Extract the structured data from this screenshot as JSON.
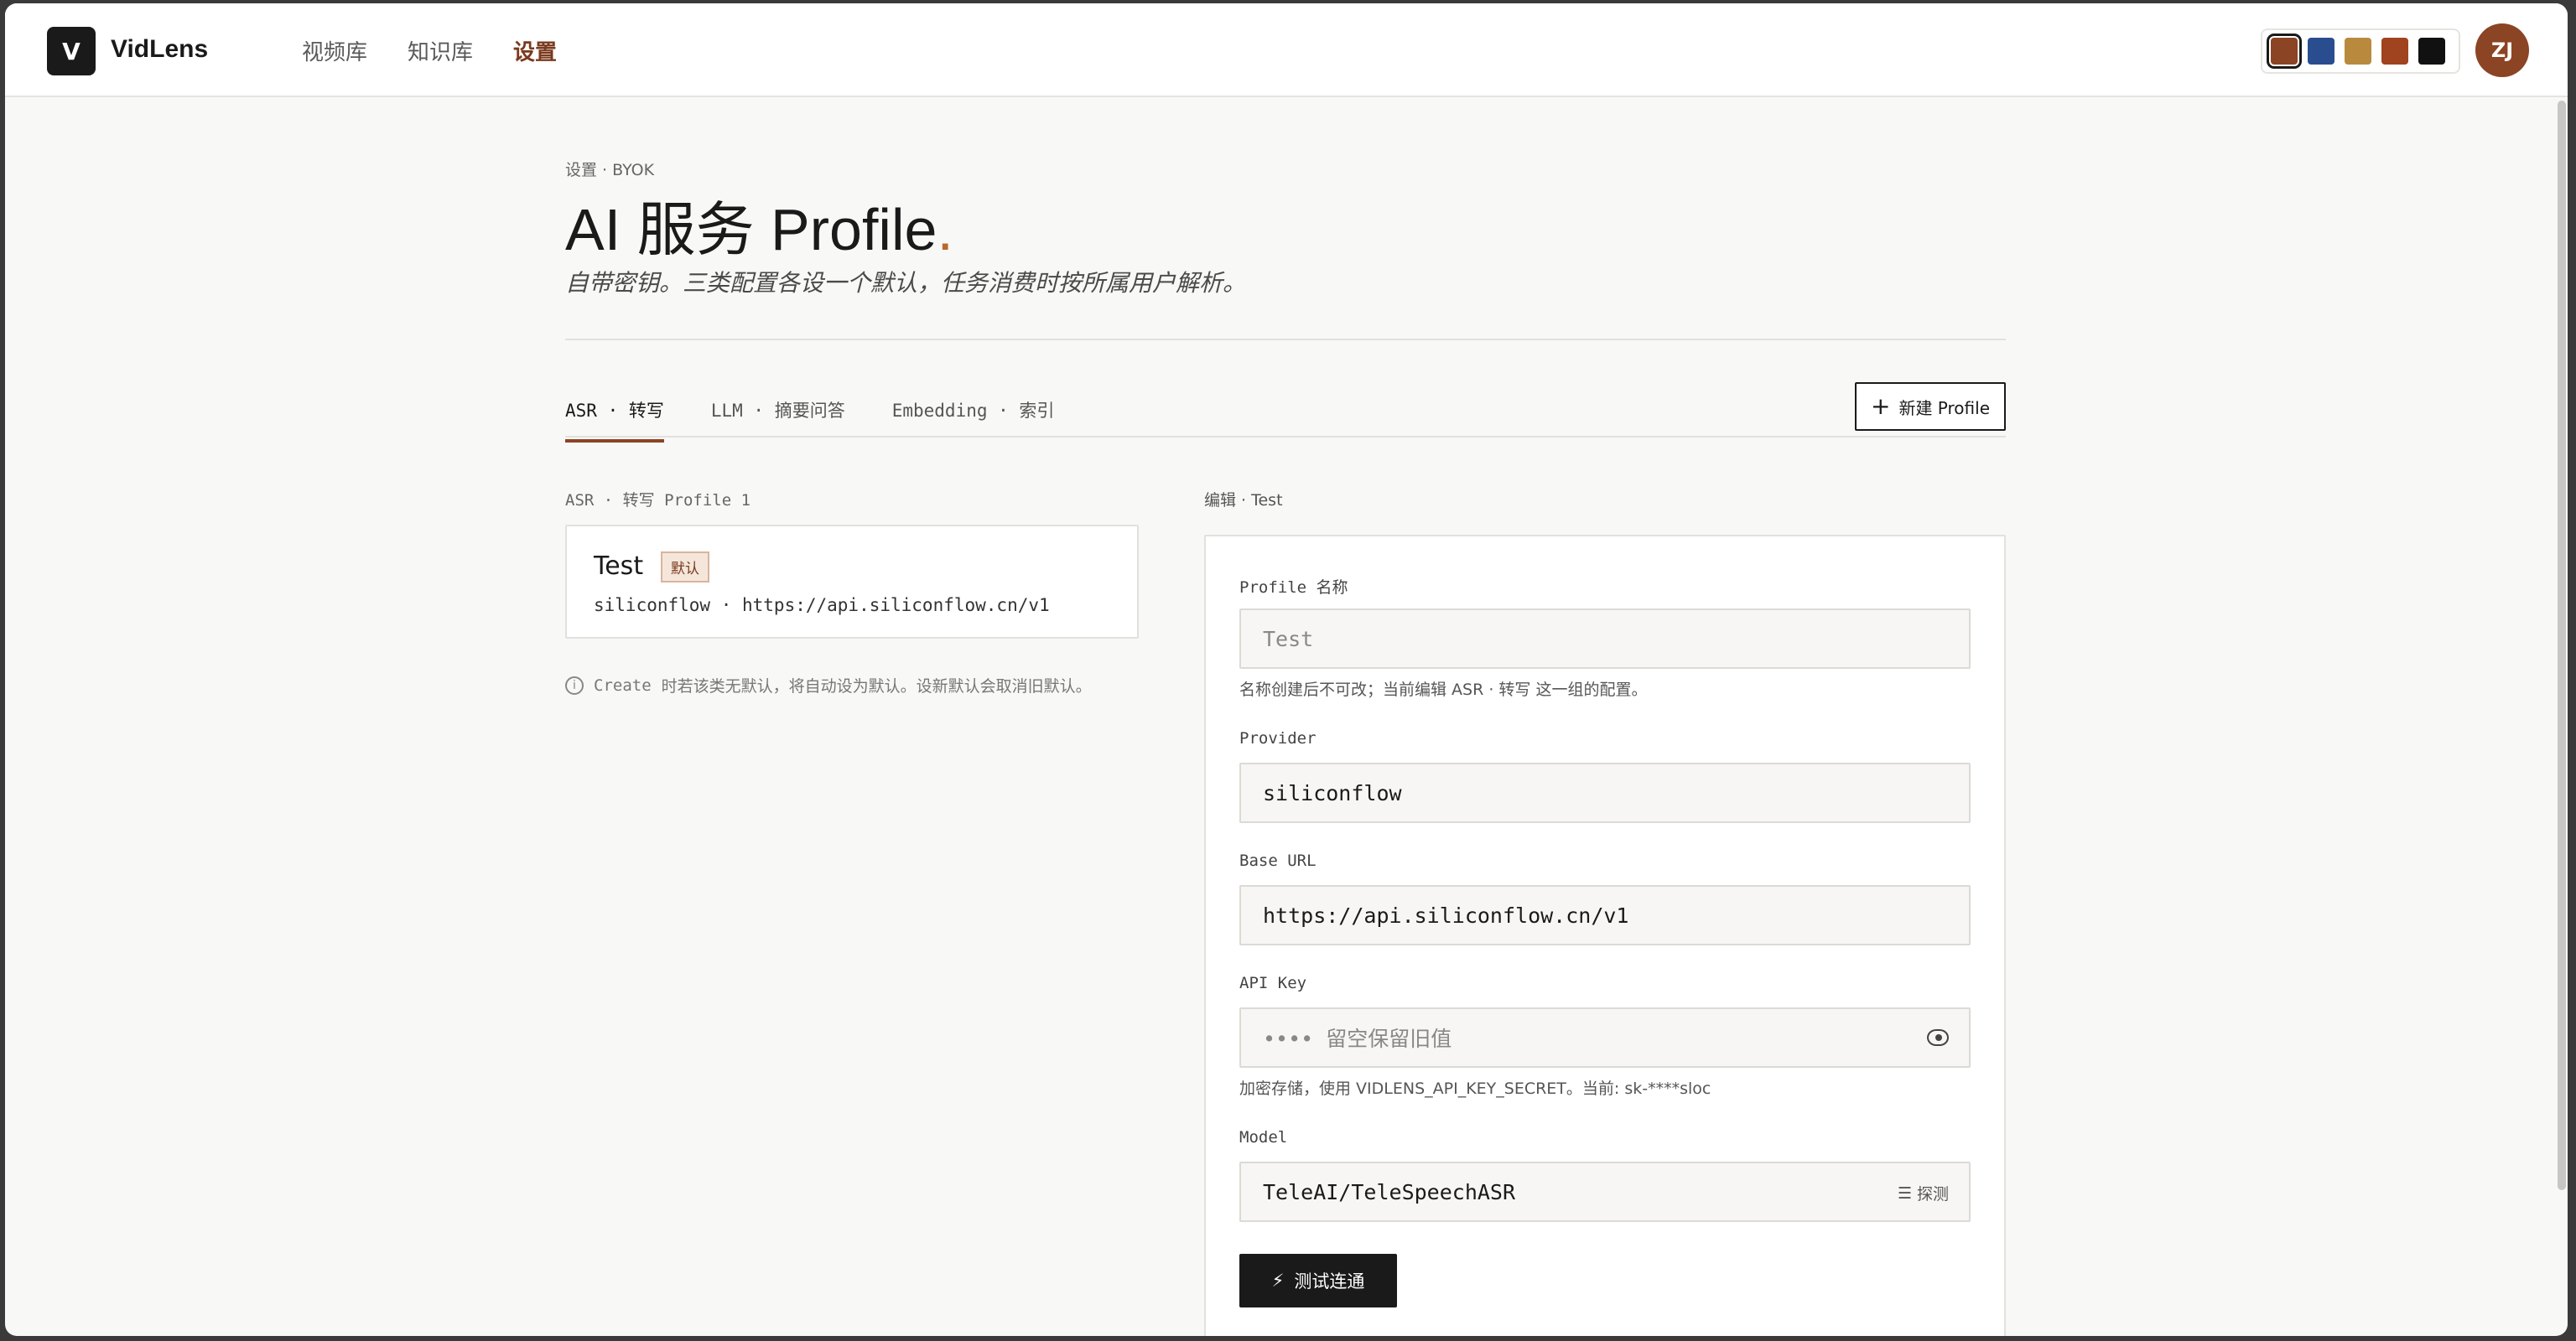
{
  "brand": {
    "logo_letter": "V",
    "name": "VidLens"
  },
  "nav": {
    "items": [
      "视频库",
      "知识库",
      "设置"
    ],
    "active": "设置"
  },
  "theme_swatches": [
    "#8b4424",
    "#2a4d8f",
    "#b98a3e",
    "#a0431f",
    "#111111"
  ],
  "avatar": "ZJ",
  "header": {
    "breadcrumb": "设置 · BYOK",
    "title": "AI 服务 Profile",
    "title_dot": ".",
    "subtitle": "自带密钥。三类配置各设一个默认，任务消费时按所属用户解析。"
  },
  "tabs": [
    {
      "label": "ASR · 转写",
      "active": true
    },
    {
      "label": "LLM · 摘要问答",
      "active": false
    },
    {
      "label": "Embedding · 索引",
      "active": false
    }
  ],
  "new_button": {
    "icon": "plus-icon",
    "label": "新建 Profile"
  },
  "list": {
    "heading": "ASR · 转写 Profile 1",
    "profiles": [
      {
        "name": "Test",
        "badge": "默认",
        "subtitle": "siliconflow · https://api.siliconflow.cn/v1"
      }
    ],
    "note_prefix": "Create",
    "note_text": "时若该类无默认，将自动设为默认。设新默认会取消旧默认。"
  },
  "editor": {
    "heading": "编辑 · Test",
    "profile_name": {
      "label": "Profile 名称",
      "value": "Test",
      "hint": "名称创建后不可改；当前编辑 ASR · 转写 这一组的配置。"
    },
    "provider": {
      "label": "Provider",
      "value": "siliconflow"
    },
    "base_url": {
      "label": "Base URL",
      "value": "https://api.siliconflow.cn/v1"
    },
    "api_key": {
      "label": "API Key",
      "placeholder": "•••• 留空保留旧值",
      "hint": "加密存储，使用 VIDLENS_API_KEY_SECRET。当前: sk-****sloc"
    },
    "model": {
      "label": "Model",
      "value": "TeleAI/TeleSpeechASR",
      "probe_label": "探测"
    },
    "test_button": "测试连通"
  }
}
